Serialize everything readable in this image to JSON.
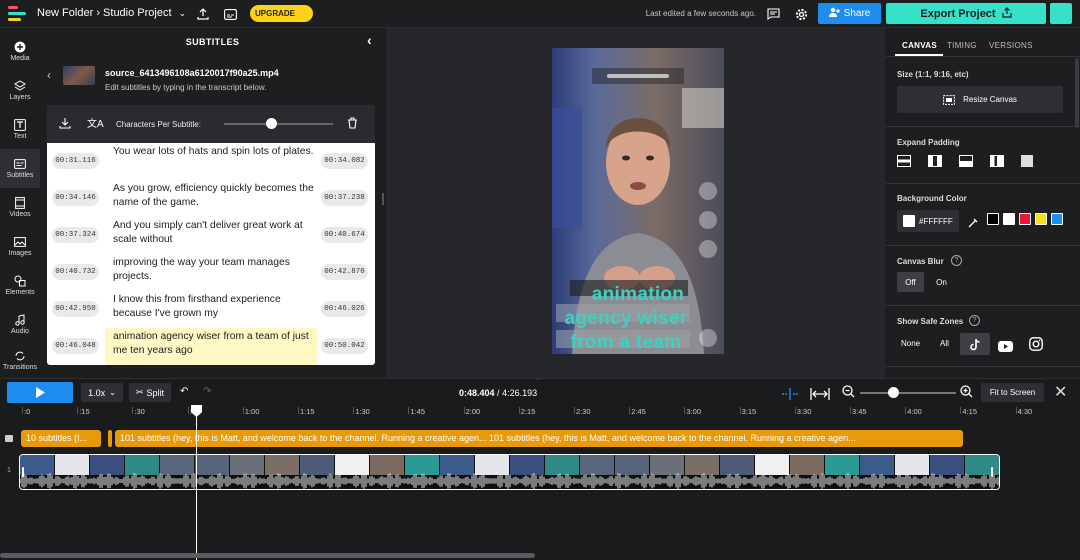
{
  "topbar": {
    "breadcrumb_folder": "New Folder",
    "breadcrumb_sep": "›",
    "project_name": "Studio Project",
    "upgrade_label": "UPGRADE",
    "last_edited": "Last edited a few seconds ago.",
    "share_label": "Share",
    "export_label": "Export Project"
  },
  "leftnav": {
    "items": [
      {
        "label": "Media",
        "icon": "plus-circle-icon"
      },
      {
        "label": "Layers",
        "icon": "layers-icon"
      },
      {
        "label": "Text",
        "icon": "text-icon"
      },
      {
        "label": "Subtitles",
        "icon": "subtitles-icon"
      },
      {
        "label": "Videos",
        "icon": "film-icon"
      },
      {
        "label": "Images",
        "icon": "image-icon"
      },
      {
        "label": "Elements",
        "icon": "shapes-icon"
      },
      {
        "label": "Audio",
        "icon": "music-note-icon"
      },
      {
        "label": "Transitions",
        "icon": "transitions-icon"
      }
    ],
    "active": "Subtitles"
  },
  "subtitles_panel": {
    "title": "SUBTITLES",
    "file_name": "source_6413496108a6120017f90a25.mp4",
    "file_desc": "Edit subtitles by typing in the transcript below.",
    "chars_per_subtitle_label": "Characters Per Subtitle:",
    "chars_per_subtitle_value": 0.43,
    "rows": [
      {
        "start": "00:31.116",
        "end": "00:34.082",
        "text": "You wear lots of hats and spin lots of plates.",
        "highlight": false
      },
      {
        "start": "00:34.146",
        "end": "00:37.238",
        "text": "As you grow, efficiency quickly becomes the name of the game.",
        "highlight": false
      },
      {
        "start": "00:37.324",
        "end": "00:40.674",
        "text": "And you simply can't deliver great work at scale without",
        "highlight": false
      },
      {
        "start": "00:40.732",
        "end": "00:42.870",
        "text": "improving the way your team manages projects.",
        "highlight": false
      },
      {
        "start": "00:42.950",
        "end": "00:46.026",
        "text": "I know this from firsthand experience because I've grown my",
        "highlight": false
      },
      {
        "start": "00:46.048",
        "end": "00:50.042",
        "text": "animation agency wiser from a team of just me ten years ago",
        "highlight": true
      }
    ]
  },
  "canvas_preview": {
    "caption_lines": [
      "animation",
      "agency wiser",
      "from a team"
    ],
    "caption_color": "#3fd0bf"
  },
  "right_panel": {
    "tabs": [
      "CANVAS",
      "TIMING",
      "VERSIONS"
    ],
    "active_tab": "CANVAS",
    "size_label": "Size (1:1, 9:16, etc)",
    "resize_label": "Resize Canvas",
    "expand_padding_label": "Expand Padding",
    "background_color_label": "Background Color",
    "background_color_value": "#FFFFFF",
    "color_presets": [
      "#000000",
      "#FFFFFF",
      "#E8173A",
      "#F2E11C",
      "#1E8FF0"
    ],
    "canvas_blur_label": "Canvas Blur",
    "blur_off": "Off",
    "blur_on": "On",
    "safe_zones_label": "Show Safe Zones",
    "safe_none": "None",
    "safe_all": "All"
  },
  "timeline": {
    "speed": "1.0x",
    "split_label": "Split",
    "current_time": "0:48.404",
    "time_sep": "/",
    "total_time": "4:26.193",
    "zoom_level": 0.55,
    "fit_label": "Fit to Screen",
    "ticks": [
      ":0",
      ":15",
      ":30",
      ":45",
      "1:00",
      "1:15",
      "1:30",
      "1:45",
      "2:00",
      "2:15",
      "2:30",
      "2:45",
      "3:00",
      "3:15",
      "3:30",
      "3:45",
      "4:00",
      "4:15",
      "4:30"
    ],
    "subtitle_track_1": "10 subtitles (I...",
    "subtitle_track_2": "101 subtitles (hey, this is Matt, and welcome back to the channel. Running a creative agen... 101 subtitles (hey, this is Matt, and welcome back to the channel. Running a creative agen...",
    "track_number": "1"
  },
  "colors": {
    "accent_blue": "#1f8cf0",
    "accent_teal": "#37e0c8",
    "upgrade_yellow": "#ffd21a",
    "subtitle_orange": "#e99a0c"
  }
}
